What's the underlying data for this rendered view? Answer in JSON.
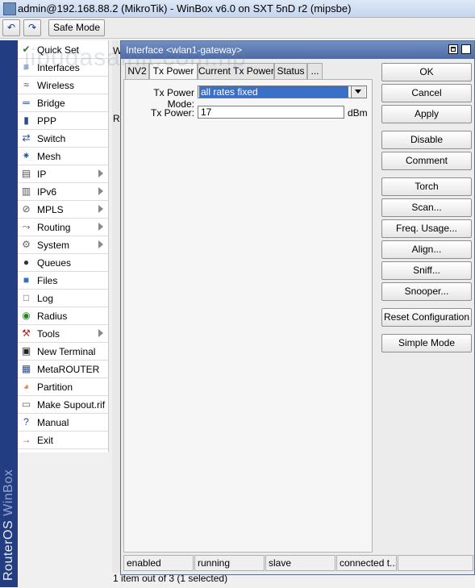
{
  "window": {
    "title": "admin@192.168.88.2 (MikroTik) - WinBox v6.0 on SXT 5nD r2 (mipsbe)"
  },
  "toolbar": {
    "undo_icon": "undo-icon",
    "redo_icon": "redo-icon",
    "safe_mode": "Safe Mode"
  },
  "brand": {
    "strip_text_a": "RouterOS",
    "strip_text_b": "WinBox"
  },
  "sidebar": {
    "items": [
      {
        "label": "Quick Set",
        "icon": "quickset-icon",
        "submenu": false
      },
      {
        "label": "Interfaces",
        "icon": "interfaces-icon",
        "submenu": false
      },
      {
        "label": "Wireless",
        "icon": "wireless-icon",
        "submenu": false
      },
      {
        "label": "Bridge",
        "icon": "bridge-icon",
        "submenu": false
      },
      {
        "label": "PPP",
        "icon": "ppp-icon",
        "submenu": false
      },
      {
        "label": "Switch",
        "icon": "switch-icon",
        "submenu": false
      },
      {
        "label": "Mesh",
        "icon": "mesh-icon",
        "submenu": false
      },
      {
        "label": "IP",
        "icon": "ip-icon",
        "submenu": true
      },
      {
        "label": "IPv6",
        "icon": "ipv6-icon",
        "submenu": true
      },
      {
        "label": "MPLS",
        "icon": "mpls-icon",
        "submenu": true
      },
      {
        "label": "Routing",
        "icon": "routing-icon",
        "submenu": true
      },
      {
        "label": "System",
        "icon": "system-icon",
        "submenu": true
      },
      {
        "label": "Queues",
        "icon": "queues-icon",
        "submenu": false
      },
      {
        "label": "Files",
        "icon": "files-icon",
        "submenu": false
      },
      {
        "label": "Log",
        "icon": "log-icon",
        "submenu": false
      },
      {
        "label": "Radius",
        "icon": "radius-icon",
        "submenu": false
      },
      {
        "label": "Tools",
        "icon": "tools-icon",
        "submenu": true
      },
      {
        "label": "New Terminal",
        "icon": "terminal-icon",
        "submenu": false
      },
      {
        "label": "MetaROUTER",
        "icon": "metarouter-icon",
        "submenu": false
      },
      {
        "label": "Partition",
        "icon": "partition-icon",
        "submenu": false
      },
      {
        "label": "Make Supout.rif",
        "icon": "supout-icon",
        "submenu": false
      },
      {
        "label": "Manual",
        "icon": "manual-icon",
        "submenu": false
      },
      {
        "label": "Exit",
        "icon": "exit-icon",
        "submenu": false
      }
    ]
  },
  "background_window": {
    "title_char": "W",
    "row_marker": "R",
    "status": "1 item out of 3 (1 selected)"
  },
  "dialog": {
    "title": "Interface <wlan1-gateway>",
    "tabs": [
      "NV2",
      "Tx Power",
      "Current Tx Power",
      "Status",
      "..."
    ],
    "active_tab": "Tx Power",
    "fields": {
      "mode_label": "Tx Power Mode:",
      "mode_value": "all rates fixed",
      "power_label": "Tx Power:",
      "power_value": "17",
      "power_unit": "dBm"
    },
    "status_bar": [
      "enabled",
      "running",
      "slave",
      "connected t..."
    ],
    "buttons": [
      "OK",
      "Cancel",
      "Apply",
      "Disable",
      "Comment",
      "Torch",
      "Scan...",
      "Freq. Usage...",
      "Align...",
      "Sniff...",
      "Snooper...",
      "Reset Configuration",
      "Simple Mode"
    ]
  },
  "watermark": "jipudasainit.com.np"
}
